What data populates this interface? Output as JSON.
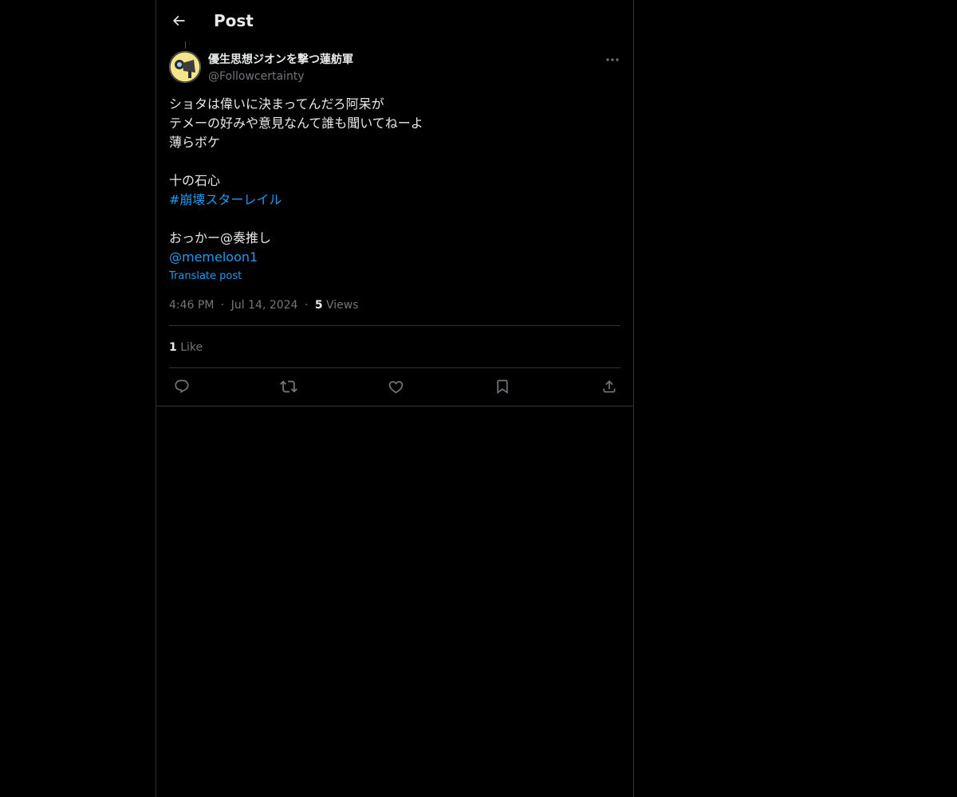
{
  "header": {
    "title": "Post"
  },
  "author": {
    "display_name": "優生思想ジオンを撃つ蓮舫軍",
    "handle": "@Followcertainty",
    "avatar_color": "#f3e58a"
  },
  "post": {
    "lines": [
      {
        "text": "ショタは偉いに決まってんだろ阿呆が",
        "type": "text"
      },
      {
        "text": "テメーの好みや意見なんて誰も聞いてねーよ",
        "type": "text"
      },
      {
        "text": "薄らボケ",
        "type": "text"
      },
      {
        "text": "",
        "type": "blank"
      },
      {
        "text": "十の石心",
        "type": "text"
      },
      {
        "text": "#崩壊スターレイル",
        "type": "hashtag"
      },
      {
        "text": "",
        "type": "blank"
      },
      {
        "text": "おっかー@奏推し",
        "type": "text"
      },
      {
        "text": "@memeloon1",
        "type": "mention"
      }
    ],
    "translate_label": "Translate post",
    "time": "4:46 PM",
    "date": "Jul 14, 2024",
    "separator": "·",
    "views_count": "5",
    "views_label": "Views"
  },
  "engagement": {
    "likes_count": "1",
    "likes_label": "Like"
  },
  "colors": {
    "background": "#000000",
    "text": "#e7e9ea",
    "secondary": "#71767b",
    "link": "#1d9bf0",
    "border": "#2f3336"
  },
  "actions": [
    {
      "name": "reply-icon"
    },
    {
      "name": "repost-icon"
    },
    {
      "name": "like-icon"
    },
    {
      "name": "bookmark-icon"
    },
    {
      "name": "share-icon"
    }
  ]
}
